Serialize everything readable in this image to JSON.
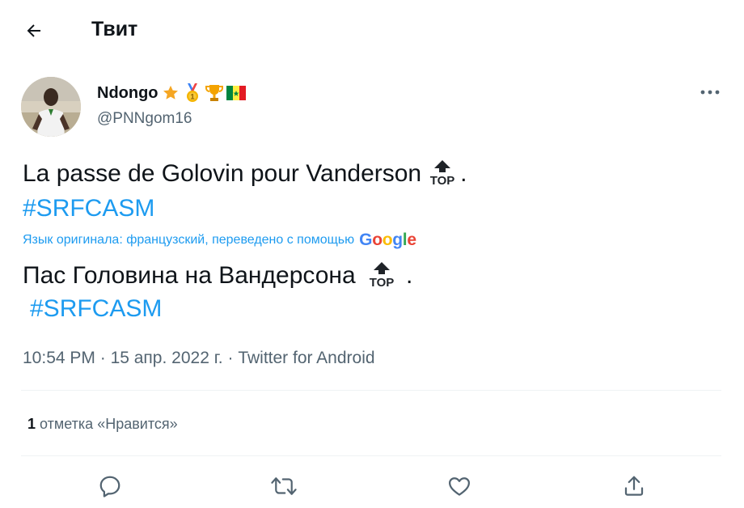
{
  "header": {
    "title": "Твит",
    "back_icon": "arrow-left-icon"
  },
  "author": {
    "name": "Ndongo",
    "handle": "@PNNgom16",
    "badges": [
      "star-icon",
      "medal-icon",
      "trophy-icon",
      "senegal-flag-icon"
    ]
  },
  "tweet": {
    "original_text": "La passe de Golovin pour Vanderson",
    "original_suffix": ".",
    "original_hashtag": "#SRFCASM",
    "translation_note": "Язык оригинала: французский, переведено с помощью",
    "translation_provider": "Google",
    "translated_text": "Пас Головина на Вандерсона",
    "translated_suffix": " .",
    "translated_hashtag": "#SRFCASM",
    "emoji": "TOP"
  },
  "meta": {
    "time": "10:54 PM",
    "separator": " · ",
    "date": "15 апр. 2022 г.",
    "source": "Twitter for Android"
  },
  "stats": {
    "likes_count": "1",
    "likes_label": " отметка «Нравится»"
  },
  "actions": [
    "reply-icon",
    "retweet-icon",
    "like-icon",
    "share-icon"
  ],
  "colors": {
    "accent": "#1d9bf0",
    "text": "#0f1419",
    "secondary": "#536471",
    "divider": "#eff3f4"
  }
}
